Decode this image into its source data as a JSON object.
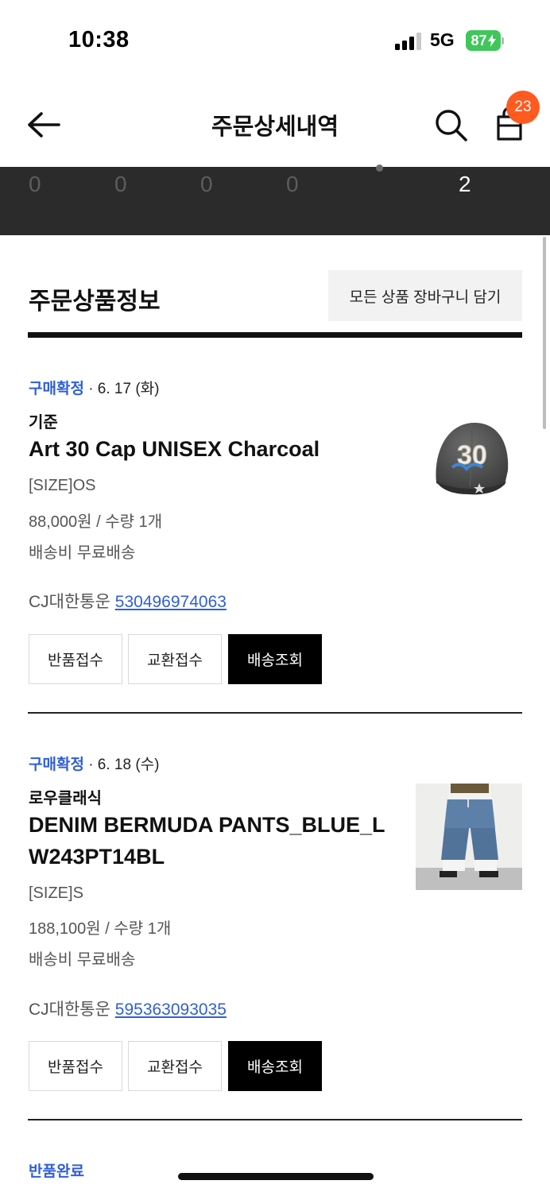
{
  "status_bar": {
    "time": "10:38",
    "network": "5G",
    "battery": "87"
  },
  "header": {
    "title": "주문상세내역",
    "cart_count": "23"
  },
  "status_strip": {
    "counts": [
      "0",
      "0",
      "0",
      "0",
      "2"
    ]
  },
  "section": {
    "title": "주문상품정보",
    "add_all_to_cart": "모든 상품 장바구니 담기"
  },
  "orders": [
    {
      "status": "구매확정",
      "date": " · 6. 17 (화)",
      "brand": "기준",
      "name": "Art 30 Cap UNISEX Charcoal",
      "size": "[SIZE]OS",
      "price_qty": "88,000원 / 수량 1개",
      "shipping": "배송비 무료배송",
      "courier": "CJ대한통운 ",
      "tracking": "530496974063",
      "buttons": {
        "return": "반품접수",
        "exchange": "교환접수",
        "track": "배송조회"
      }
    },
    {
      "status": "구매확정",
      "date": " · 6. 18 (수)",
      "brand": "로우클래식",
      "name": "DENIM BERMUDA PANTS_BLUE_LW243PT14BL",
      "size": "[SIZE]S",
      "price_qty": "188,100원 / 수량 1개",
      "shipping": "배송비 무료배송",
      "courier": "CJ대한통운 ",
      "tracking": "595363093035",
      "buttons": {
        "return": "반품접수",
        "exchange": "교환접수",
        "track": "배송조회"
      }
    },
    {
      "status": "반품완료"
    }
  ],
  "colors": {
    "accent_blue": "#2f5fd8",
    "badge_orange": "#ff5a1f",
    "strip_dark": "#2b2b2b",
    "battery_green": "#3fc75a"
  },
  "icons": [
    "back-arrow-icon",
    "search-icon",
    "shopping-bag-icon",
    "signal-icon",
    "battery-icon"
  ]
}
